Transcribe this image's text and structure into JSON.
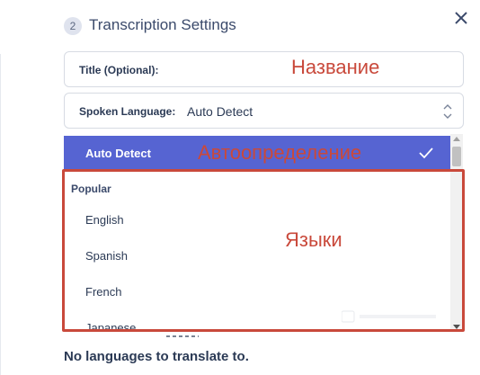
{
  "header": {
    "step_number": "2",
    "title": "Transcription Settings"
  },
  "fields": {
    "title": {
      "label": "Title (Optional):",
      "value": ""
    },
    "language": {
      "label": "Spoken Language:",
      "value": "Auto Detect"
    }
  },
  "dropdown": {
    "selected": "Auto Detect",
    "group": "Popular",
    "options": [
      "English",
      "Spanish",
      "French",
      "Japanese"
    ]
  },
  "annotations": {
    "title": "Название",
    "auto_detect": "Автоопределение",
    "languages": "Языки"
  },
  "footer": {
    "message": "No languages to translate to."
  },
  "colors": {
    "selected_bg": "#5664d2",
    "annotation": "#c9493b",
    "text": "#2b3a55"
  }
}
